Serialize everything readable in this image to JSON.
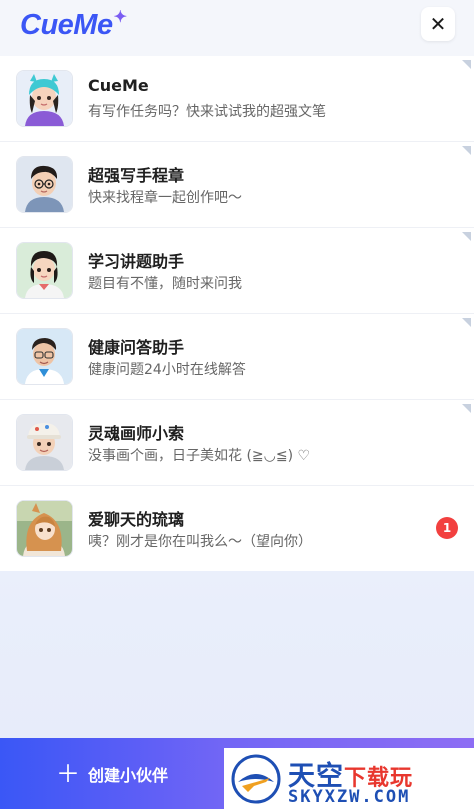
{
  "header": {
    "logo": "CueMe",
    "close_icon": "✕"
  },
  "chats": [
    {
      "name": "CueMe",
      "message": "有写作任务吗？快来试试我的超强文笔",
      "avatar": "girl-beanie-avatar"
    },
    {
      "name": "超强写手程章",
      "message": "快来找程章一起创作吧～",
      "avatar": "boy-glasses-avatar"
    },
    {
      "name": "学习讲题助手",
      "message": "题目有不懂，随时来问我",
      "avatar": "girl-student-avatar"
    },
    {
      "name": "健康问答助手",
      "message": "健康问题24小时在线解答",
      "avatar": "doctor-avatar"
    },
    {
      "name": "灵魂画师小索",
      "message": "没事画个画，日子美如花 (≧◡≦) ♡",
      "avatar": "painter-boy-avatar"
    },
    {
      "name": "爱聊天的琉璃",
      "message": "咦？刚才是你在叫我么～（望向你）",
      "avatar": "anime-girl-avatar",
      "badge": "1"
    }
  ],
  "create_button": {
    "label": "创建小伙伴",
    "icon": "plus-icon"
  },
  "ad": {
    "title_part1": "天空",
    "title_part2": "下载玩",
    "url": "SKYXZW.COM"
  },
  "colors": {
    "accent": "#3b56f5",
    "badge": "#f2403f"
  }
}
